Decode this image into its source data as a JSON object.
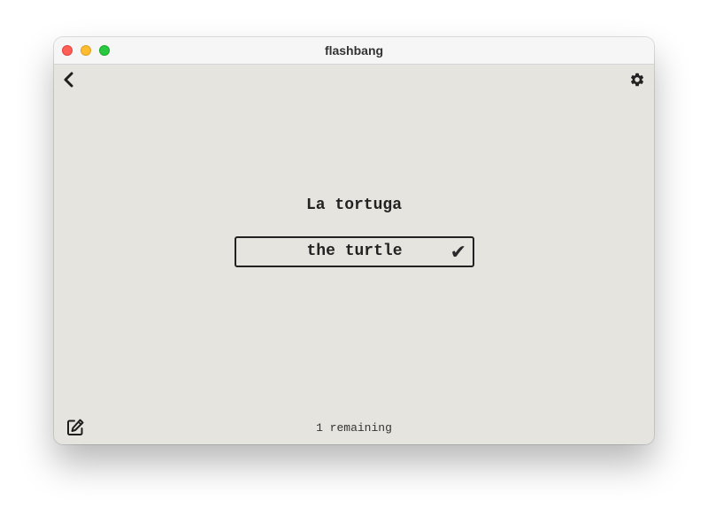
{
  "window": {
    "title": "flashbang"
  },
  "toolbar": {
    "back_icon": "chevron-left-icon",
    "settings_icon": "gear-icon"
  },
  "card": {
    "prompt": "La tortuga",
    "answer_value": "the turtle",
    "status_icon": "checkmark-icon",
    "status_glyph": "✔"
  },
  "footer": {
    "edit_icon": "edit-icon",
    "remaining_label": "1 remaining"
  },
  "colors": {
    "background": "#e6e4df",
    "text": "#222222",
    "close": "#ff5f57",
    "minimize": "#febc2e",
    "maximize": "#28c840"
  }
}
